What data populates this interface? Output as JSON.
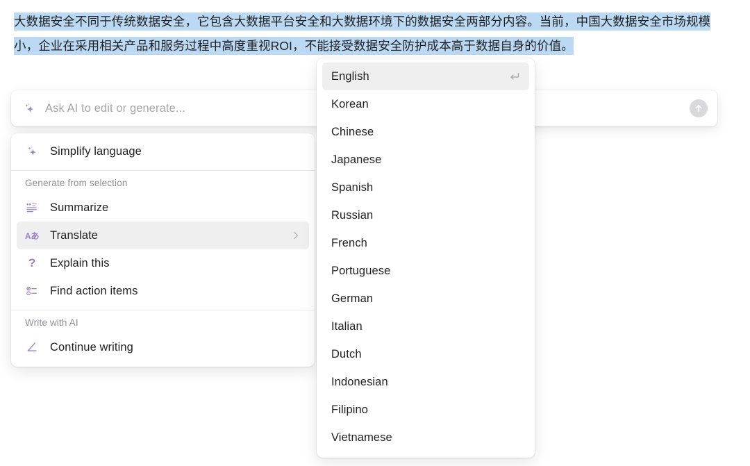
{
  "document": {
    "selected_text": "大数据安全不同于传统数据安全，它包含大数据平台安全和大数据环境下的数据安全两部分内容。当前，中国大数据安全市场规模小，企业在采用相关产品和服务过程中高度重视ROI，不能接受数据安全防护成本高于数据自身的价值。",
    "selection_highlight_color": "#bbd9f2"
  },
  "ai_bar": {
    "placeholder": "Ask AI to edit or generate...",
    "value": "",
    "leading_icon": "sparkle-icon",
    "submit_icon": "arrow-up-icon"
  },
  "ai_menu": {
    "accent_color": "#9b7fc4",
    "hover_color": "#efeff0",
    "top_items": [
      {
        "label": "Simplify language",
        "icon": "sparkle-icon",
        "active": false,
        "submenu": false
      }
    ],
    "sections": [
      {
        "title": "Generate from selection",
        "items": [
          {
            "label": "Summarize",
            "icon": "quote-lines-icon",
            "active": false,
            "submenu": false
          },
          {
            "label": "Translate",
            "icon": "language-a-icon",
            "active": true,
            "submenu": true
          },
          {
            "label": "Explain this",
            "icon": "question-mark-icon",
            "active": false,
            "submenu": false
          },
          {
            "label": "Find action items",
            "icon": "checklist-icon",
            "active": false,
            "submenu": false
          }
        ]
      },
      {
        "title": "Write with AI",
        "items": [
          {
            "label": "Continue writing",
            "icon": "pen-write-icon",
            "active": false,
            "submenu": false
          }
        ]
      }
    ],
    "icon_glyphs": {
      "language-a-icon": "Aあ",
      "question-mark-icon": "?"
    }
  },
  "language_menu": {
    "items": [
      {
        "label": "English",
        "active": true,
        "shortcut_icon": "return-arrow-icon"
      },
      {
        "label": "Korean",
        "active": false,
        "shortcut_icon": ""
      },
      {
        "label": "Chinese",
        "active": false,
        "shortcut_icon": ""
      },
      {
        "label": "Japanese",
        "active": false,
        "shortcut_icon": ""
      },
      {
        "label": "Spanish",
        "active": false,
        "shortcut_icon": ""
      },
      {
        "label": "Russian",
        "active": false,
        "shortcut_icon": ""
      },
      {
        "label": "French",
        "active": false,
        "shortcut_icon": ""
      },
      {
        "label": "Portuguese",
        "active": false,
        "shortcut_icon": ""
      },
      {
        "label": "German",
        "active": false,
        "shortcut_icon": ""
      },
      {
        "label": "Italian",
        "active": false,
        "shortcut_icon": ""
      },
      {
        "label": "Dutch",
        "active": false,
        "shortcut_icon": ""
      },
      {
        "label": "Indonesian",
        "active": false,
        "shortcut_icon": ""
      },
      {
        "label": "Filipino",
        "active": false,
        "shortcut_icon": ""
      },
      {
        "label": "Vietnamese",
        "active": false,
        "shortcut_icon": ""
      }
    ]
  }
}
